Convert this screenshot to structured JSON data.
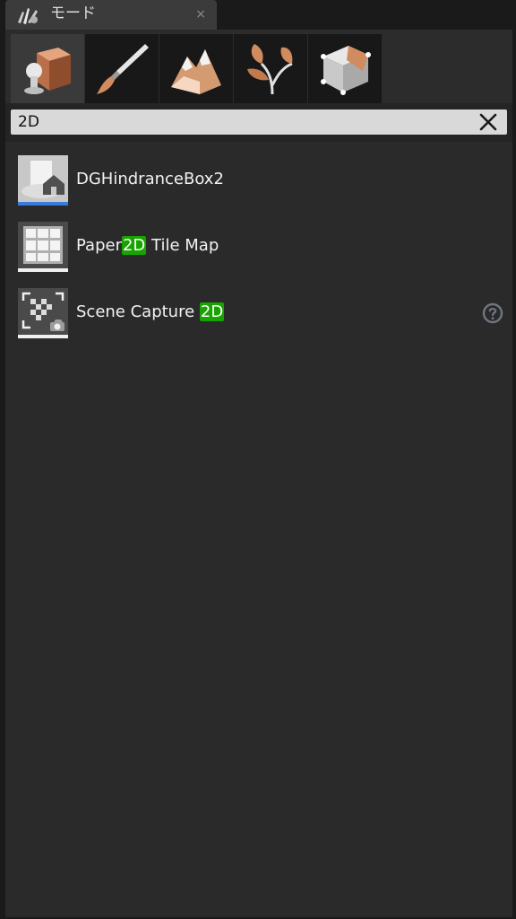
{
  "window": {
    "tab_title": "モード",
    "tab_close": "×"
  },
  "mode_tabs": [
    {
      "name": "place-mode",
      "icon": "placement-cube-icon",
      "active": true
    },
    {
      "name": "paint-mode",
      "icon": "paint-brush-icon",
      "active": false
    },
    {
      "name": "landscape-mode",
      "icon": "landscape-mountain-icon",
      "active": false
    },
    {
      "name": "foliage-mode",
      "icon": "foliage-leaf-icon",
      "active": false
    },
    {
      "name": "geometry-mode",
      "icon": "geometry-box-icon",
      "active": false
    }
  ],
  "search": {
    "value": "2D",
    "clear_icon": "close-x-icon"
  },
  "results": [
    {
      "pre": "DGHindranceBox2",
      "hl": "",
      "post": "",
      "thumb_icon": "blueprint-actor-icon",
      "help": false
    },
    {
      "pre": "Paper",
      "hl": "2D",
      "post": " Tile Map",
      "thumb_icon": "tile-map-grid-icon",
      "help": false
    },
    {
      "pre": "Scene Capture ",
      "hl": "2D",
      "post": "",
      "thumb_icon": "scene-capture-icon",
      "help": true
    }
  ],
  "colors": {
    "highlight": "#17a300",
    "accent_copper": "#c8825a",
    "selected_underline": "#3a7be0"
  }
}
